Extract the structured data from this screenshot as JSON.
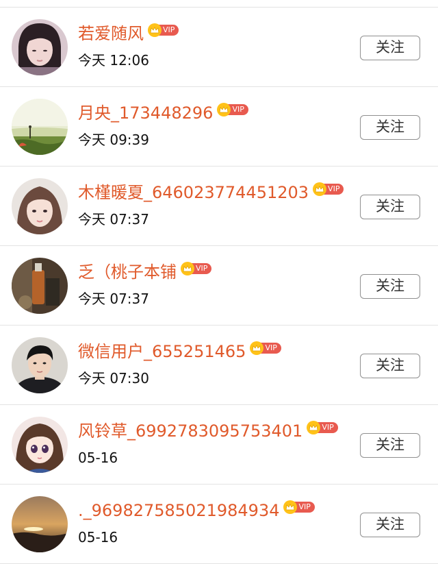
{
  "users": [
    {
      "name": "若爱随风",
      "vip_label": "VIP",
      "time": "今天 12:06",
      "follow_label": "关注",
      "avatar": "girl-portrait-avatar"
    },
    {
      "name": "月央_173448296",
      "vip_label": "VIP",
      "time": "今天 09:39",
      "follow_label": "关注",
      "avatar": "landscape-sky-avatar"
    },
    {
      "name": "木槿暖夏_646023774451203",
      "vip_label": "VIP",
      "time": "今天 07:37",
      "follow_label": "关注",
      "avatar": "woman-selfie-avatar"
    },
    {
      "name": "乏（桃子本铺",
      "vip_label": "VIP",
      "time": "今天 07:37",
      "follow_label": "关注",
      "avatar": "product-bottle-avatar"
    },
    {
      "name": "微信用户_655251465",
      "vip_label": "VIP",
      "time": "今天 07:30",
      "follow_label": "关注",
      "avatar": "young-man-avatar"
    },
    {
      "name": "风铃草_6992783095753401",
      "vip_label": "VIP",
      "time": "05-16",
      "follow_label": "关注",
      "avatar": "anime-girl-avatar"
    },
    {
      "name": "._969827585021984934",
      "vip_label": "VIP",
      "time": "05-16",
      "follow_label": "关注",
      "avatar": "sunset-avatar"
    }
  ],
  "colors": {
    "name": "#e05a2b",
    "vip_badge": "#e85a4f",
    "crown": "#ffc219",
    "divider": "#e3e3e3",
    "button_border": "#8f8f8f"
  }
}
